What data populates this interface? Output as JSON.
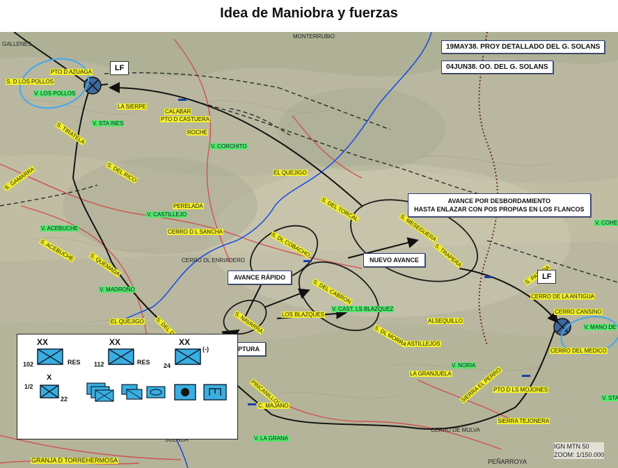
{
  "title": "Idea de Maniobra y fuerzas",
  "boxes": {
    "proy": "19MAY38. PROY DETALLADO DEL G. SOLANS",
    "oo": "04JUN38. OO.  DEL G. SOLANS"
  },
  "callouts": {
    "avance_desbordamiento_1": "AVANCE POR DESBORDAMIENTO",
    "avance_desbordamiento_2": "HASTA ENLAZAR CON POS PROPIAS EN LOS FLANCOS",
    "nuevo_avance": "NUEVO AVANCE",
    "avance_rapido": "AVANCE RÁPIDO",
    "ruptura": "RUPTURA"
  },
  "lf_labels": [
    "LF",
    "LF"
  ],
  "scale_info": {
    "line1": "IGN MTN 50",
    "line2": "ZOOM: 1/150.000"
  },
  "legend": {
    "units": [
      {
        "number": "102",
        "suffix": "RES",
        "echelon": "XX"
      },
      {
        "number": "112",
        "suffix": "RES",
        "echelon": "XX"
      },
      {
        "number": "24",
        "suffix": "(-)",
        "echelon": "XX"
      }
    ],
    "row2_left_top": "1/2",
    "row2_left_bottom": "22",
    "row2_left_echelon": "X"
  },
  "place_labels": {
    "gallenes": "GALLENES",
    "monterrubio": "MONTERRUBIO",
    "pto_d_azuaga": "PTO D AZUAGA",
    "s_dl_pollos": "S. D LOS POLLOS",
    "v_los_pollos": "V. LOS POLLOS",
    "la_sierpe": "LA SIERPE",
    "calabar": "CALABAR",
    "pto_castuera": "PTO D CASTUERA",
    "v_sta_ines": "V. STA INES",
    "roche": "ROCHE",
    "v_corchito": "V. CORCHITO",
    "s_tiratela": "S. TIRATELA",
    "s_del_rico": "S. DEL RICO",
    "el_quejigo_n": "EL QUEJIGO",
    "s_gamarra": "S. GAMARRA",
    "perelada": "PERELADA",
    "v_castillejo": "V. CASTILLEJO",
    "cerro_sancha": "CERRO D L SANCHA",
    "v_acebuche": "V. ACEBUCHE",
    "s_acebuche": "S. ACEBUCHE",
    "s_quemada": "S. QUEMADA",
    "cerro_enriadero": "CERRO DL ENRIADERO",
    "s_dl_cobacho": "S. DL COBACHO",
    "s_del_torcal": "S. DEL TORCAL",
    "s_del_cabron": "S. DEL CABRON",
    "s_meseguera": "S. MESEGUERA",
    "s_trapera": "S. TRAPERA",
    "s_navarra": "S. NAVARRA",
    "v_madrono": "V. MADROÑO",
    "el_quejigo_s": "EL QUEJIGO",
    "los_blazques": "LOS BLAZQUES",
    "v_cast_blazquez": "V. CAST. LS BLAZQUEZ",
    "s_dl_morra": "S. DL MORRA",
    "astillejos": "ASTILLEJOS",
    "alsequillo": "ALSEQUILLO",
    "s_del_ducado": "S. DEL DUCADO",
    "s_patuda": "S. PATUDA",
    "cerro_antigua": "CERRO DE LA ANTIGUA",
    "cerro_cansino": "CERRO CANSINO",
    "v_mano_de": "V. MANO DE",
    "cerro_medico": "CERRO DEL MEDICO",
    "v_noria": "V. NORIA",
    "la_granjuela": "LA GRANJUELA",
    "sierra_perro": "SIERRA EL PERRO",
    "pto_mojones": "PTO D LS MOJONES",
    "sierra_tejonera": "SIERRA TEJONERA",
    "cerro_mulva": "CERRO DE MULVA",
    "pincanillos": "PINCANILLOS",
    "c_majano": "C. MAJANO",
    "v_la_grana": "V. LA GRANA",
    "suenca": "SUENCA",
    "granja_torrehermosa": "GRANJA D TORREHERMOSA",
    "penarroya": "PEÑARROYA",
    "v_cohe": "V. COHE",
    "v_sta": "V. STA"
  },
  "colors": {
    "map_bg": "#b7b59d",
    "river": "#1f4fe0",
    "road": "#d04848",
    "rail": "#3a3a3a",
    "unit_fill": "#3aaee0",
    "ellipse_lf": "#4aa8e8"
  }
}
